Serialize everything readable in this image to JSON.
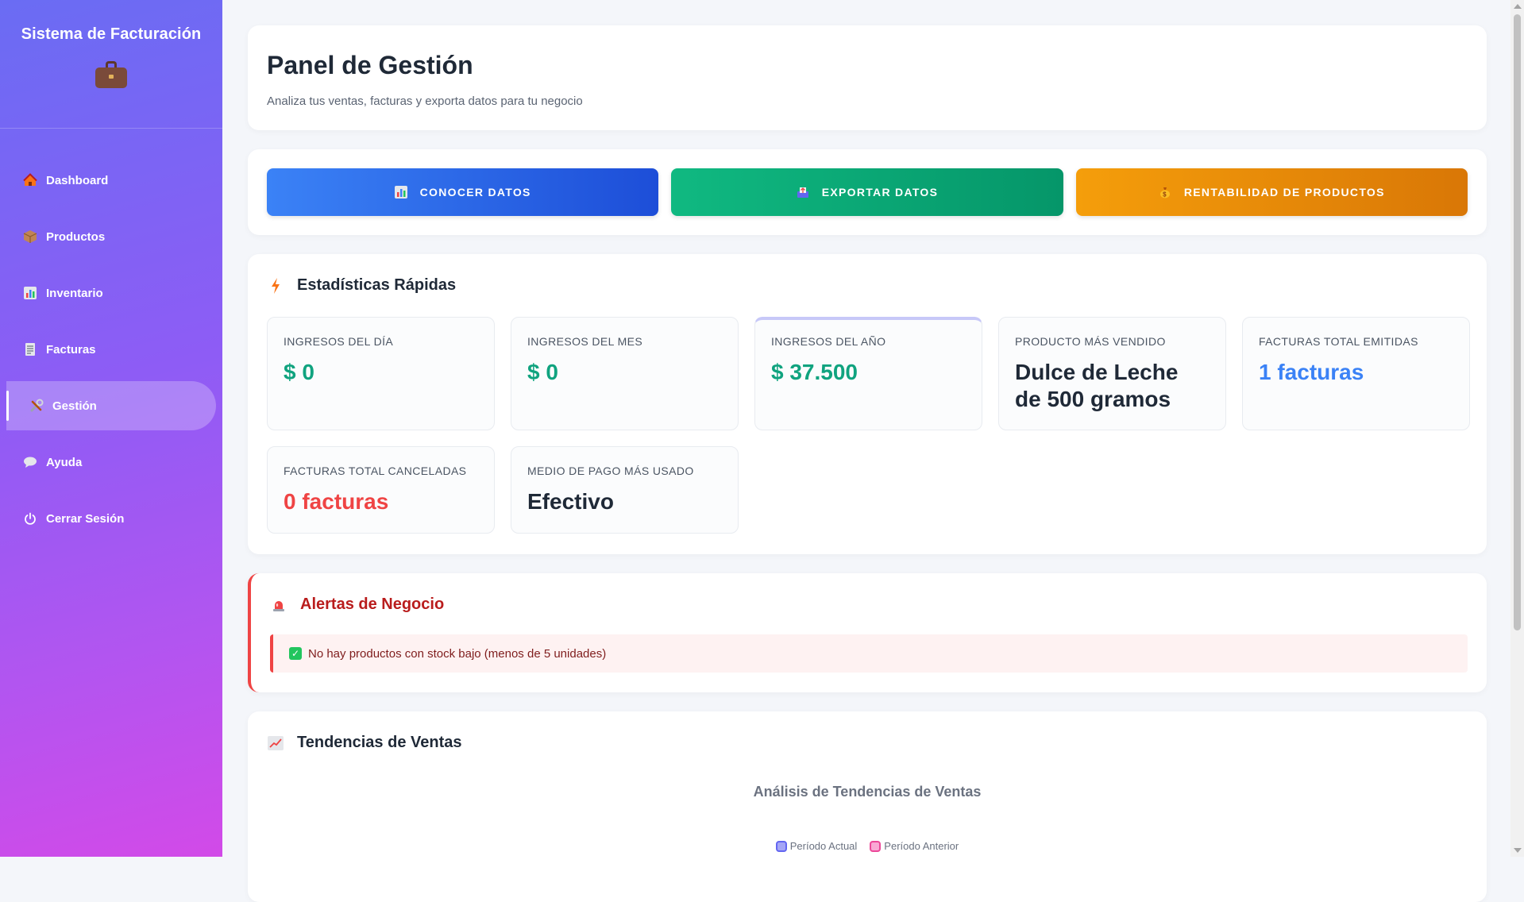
{
  "sidebar": {
    "title": "Sistema de Facturación",
    "logo_icon": "briefcase-icon",
    "items": [
      {
        "label": "Dashboard",
        "icon": "house-icon",
        "active": false
      },
      {
        "label": "Productos",
        "icon": "package-icon",
        "active": false
      },
      {
        "label": "Inventario",
        "icon": "bar-chart-icon",
        "active": false
      },
      {
        "label": "Facturas",
        "icon": "receipt-icon",
        "active": false
      },
      {
        "label": "Gestión",
        "icon": "tools-icon",
        "active": true
      },
      {
        "label": "Ayuda",
        "icon": "speech-bubble-icon",
        "active": false
      },
      {
        "label": "Cerrar Sesión",
        "icon": "power-icon",
        "active": false
      }
    ]
  },
  "header": {
    "title": "Panel de Gestión",
    "subtitle": "Analiza tus ventas, facturas y exporta datos para tu negocio"
  },
  "actions": [
    {
      "label": "CONOCER DATOS",
      "icon": "chart-icon",
      "color": "#3b82f6"
    },
    {
      "label": "EXPORTAR DATOS",
      "icon": "outbox-icon",
      "color": "#10b981"
    },
    {
      "label": "RENTABILIDAD DE PRODUCTOS",
      "icon": "money-bag-icon",
      "color": "#f59e0b"
    }
  ],
  "stats": {
    "title": "Estadísticas Rápidas",
    "icon": "lightning-icon",
    "cards": [
      {
        "label": "Ingresos del Día",
        "value": "$ 0",
        "color": "#10a37f"
      },
      {
        "label": "Ingresos del Mes",
        "value": "$ 0",
        "color": "#10a37f"
      },
      {
        "label": "Ingresos del Año",
        "value": "$ 37.500",
        "color": "#10a37f"
      },
      {
        "label": "Producto Más Vendido",
        "value": "Dulce de Leche de 500 gramos",
        "color": "#1f2937"
      },
      {
        "label": "Facturas Total Emitidas",
        "value": "1 facturas",
        "color": "#3b82f6"
      },
      {
        "label": "Facturas Total Canceladas",
        "value": "0 facturas",
        "color": "#ef4444"
      },
      {
        "label": "Medio de Pago Más Usado",
        "value": "Efectivo",
        "color": "#1f2937"
      }
    ]
  },
  "alerts": {
    "title": "Alertas de Negocio",
    "icon": "siren-icon",
    "message": "No hay productos con stock bajo (menos de 5 unidades)"
  },
  "trends": {
    "title": "Tendencias de Ventas",
    "icon": "trend-chart-icon",
    "chart_title": "Análisis de Tendencias de Ventas",
    "legend": [
      {
        "label": "Período Actual",
        "color": "#6366f1"
      },
      {
        "label": "Período Anterior",
        "color": "#ec4899"
      }
    ]
  }
}
